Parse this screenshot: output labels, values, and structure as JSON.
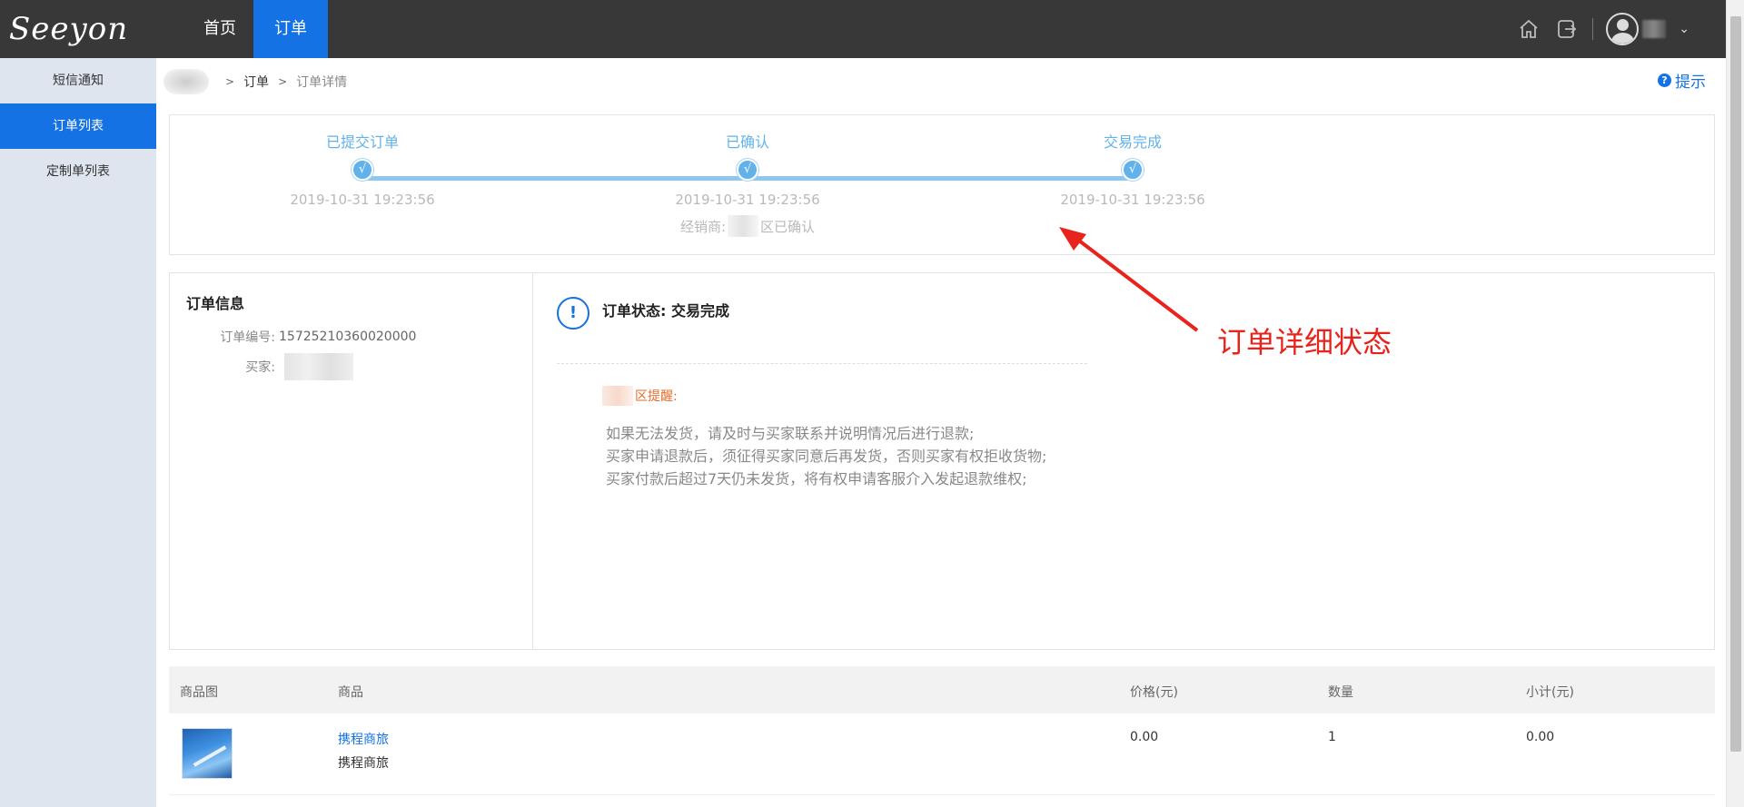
{
  "app": {
    "logo_text": "Seeyon",
    "nav": [
      {
        "label": "首页"
      },
      {
        "label": "订单"
      }
    ]
  },
  "topbar": {
    "icons": [
      "home-icon",
      "logout-icon",
      "user-avatar-icon",
      "chevron-down-icon"
    ]
  },
  "sidebar": {
    "items": [
      {
        "label": "短信通知",
        "active": false
      },
      {
        "label": "订单列表",
        "active": true
      },
      {
        "label": "定制单列表",
        "active": false
      }
    ]
  },
  "breadcrumb": {
    "items": [
      "订单",
      "订单详情"
    ],
    "separator": ">"
  },
  "hint": {
    "label": "提示"
  },
  "progress": {
    "steps": [
      {
        "label": "已提交订单",
        "time": "2019-10-31 19:23:56",
        "check": "√"
      },
      {
        "label": "已确认",
        "time": "2019-10-31 19:23:56",
        "check": "√",
        "sub_prefix": "经销商:",
        "sub_suffix": "区已确认"
      },
      {
        "label": "交易完成",
        "time": "2019-10-31 19:23:56",
        "check": "√"
      }
    ]
  },
  "order_info": {
    "title": "订单信息",
    "order_no_label": "订单编号:",
    "order_no": "15725210360020000",
    "buyer_label": "买家:"
  },
  "order_status": {
    "icon": "!",
    "text": "订单状态: 交易完成",
    "reminder_suffix": "区提醒:",
    "reminder_lines": [
      "如果无法发货，请及时与买家联系并说明情况后进行退款;",
      "买家申请退款后，须征得买家同意后再发货，否则买家有权拒收货物;",
      "买家付款后超过7天仍未发货，将有权申请客服介入发起退款维权;"
    ]
  },
  "annotation": {
    "text": "订单详细状态",
    "color": "#e8231c"
  },
  "product_table": {
    "headers": [
      "商品图",
      "商品",
      "价格(元)",
      "数量",
      "小计(元)"
    ],
    "rows": [
      {
        "name_link": "携程商旅",
        "name": "携程商旅",
        "price": "0.00",
        "qty": "1",
        "subtotal": "0.00"
      }
    ]
  },
  "colors": {
    "topbar": "#383838",
    "accent": "#1472e5",
    "sidebar": "#dfe5ef",
    "progress": "#62b2ea"
  }
}
